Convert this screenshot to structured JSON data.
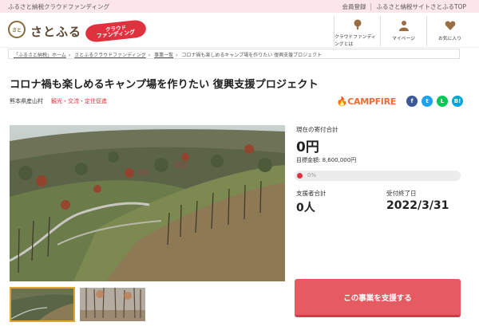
{
  "topbar": {
    "left": "ふるさと納税クラウドファンディング",
    "register": "会員登録",
    "site_top": "ふるさと納税サイトさとふるTOP"
  },
  "header": {
    "logo_text": "さとふる",
    "logo_mark": "さと",
    "badge_line1": "クラウド",
    "badge_line2": "ファンディング",
    "nav": [
      {
        "label": "クラウドファンディングとは",
        "icon": "tree-icon"
      },
      {
        "label": "マイページ",
        "icon": "person-icon"
      },
      {
        "label": "お気に入り",
        "icon": "heart-icon"
      }
    ]
  },
  "breadcrumb": [
    "「ふるさと納税」ホーム",
    "さとふるクラウドファンディング",
    "事業一覧",
    "コロナ禍も楽しめるキャンプ場を作りたい 復興支援プロジェクト"
  ],
  "project": {
    "title": "コロナ禍も楽しめるキャンプ場を作りたい 復興支援プロジェクト",
    "region": "熊本県産山村",
    "tags": "観光・交流・定住促進",
    "partner": "CAMPFIRE"
  },
  "share": {
    "facebook": "f",
    "twitter": "t",
    "line": "L",
    "hatena": "B!",
    "colors": {
      "facebook": "#3b5998",
      "twitter": "#1da1f2",
      "line": "#06c755",
      "hatena": "#00a4de"
    }
  },
  "stats": {
    "current_label": "現在の寄付合計",
    "current_value": "0円",
    "target_label": "目標金額: 8,600,000円",
    "progress_text": "0%",
    "progress_fraction": 0.0,
    "supporters_label": "支援者合計",
    "supporters_value": "0人",
    "deadline_label": "受付終了日",
    "deadline_value": "2022/3/31"
  },
  "cta": {
    "label": "この事業を支援する"
  },
  "colors": {
    "accent": "#e0313f",
    "button": "#e65a62",
    "topbar": "#fbe6ea",
    "campfire": "#f06a39"
  }
}
